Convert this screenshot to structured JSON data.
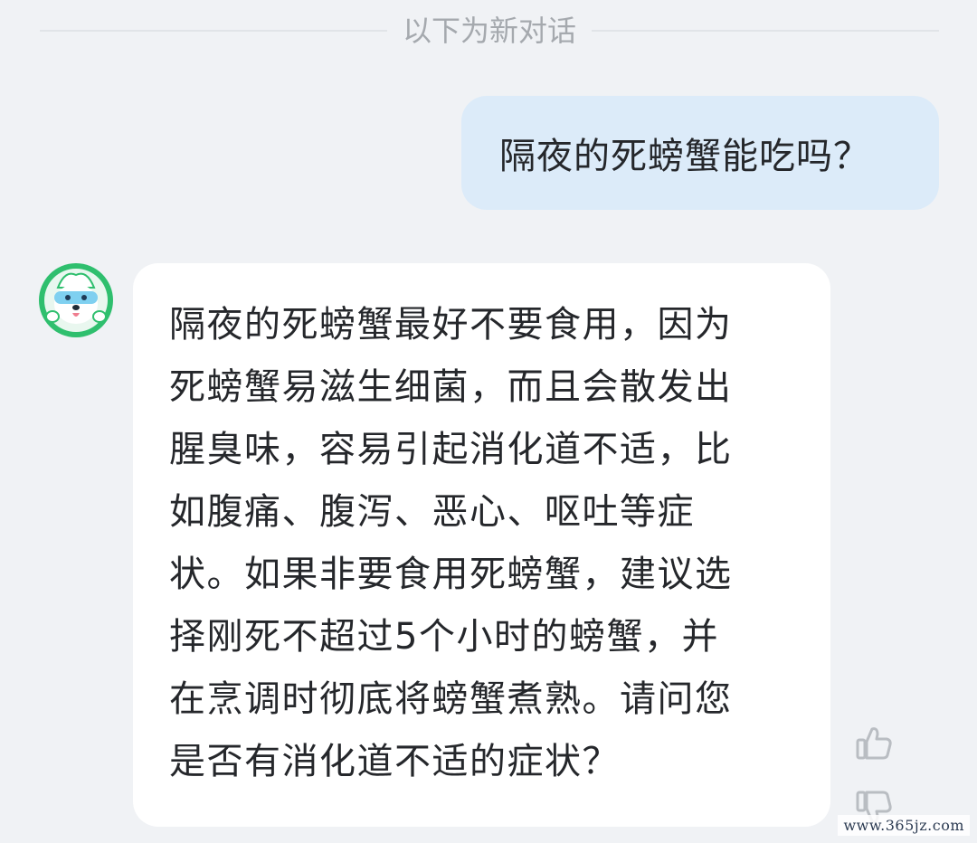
{
  "chat": {
    "divider_label": "以下为新对话",
    "user_message": "隔夜的死螃蟹能吃吗？",
    "assistant_message_lines": [
      "隔夜的死螃蟹最好不要食用，因为",
      "死螃蟹易滋生细菌，而且会散发出",
      "腥臭味，容易引起消化道不适，比",
      "如腹痛、腹泻、恶心、呕吐等症",
      "状。如果非要食用死螃蟹，建议选",
      "择刚死不超过5个小时的螃蟹，并",
      "在烹调时彻底将螃蟹煮熟。请问您",
      "是否有消化道不适的症状？"
    ]
  },
  "icons": {
    "avatar": "assistant-mascot-avatar",
    "like": "thumbs-up-icon",
    "dislike": "thumbs-down-icon"
  },
  "colors": {
    "background": "#f0f2f5",
    "user_bubble": "#dcebf9",
    "assistant_bubble": "#ffffff",
    "avatar_green": "#2fbf6e",
    "divider_text": "#a5a9ae"
  },
  "watermark": "www.365jz.com"
}
